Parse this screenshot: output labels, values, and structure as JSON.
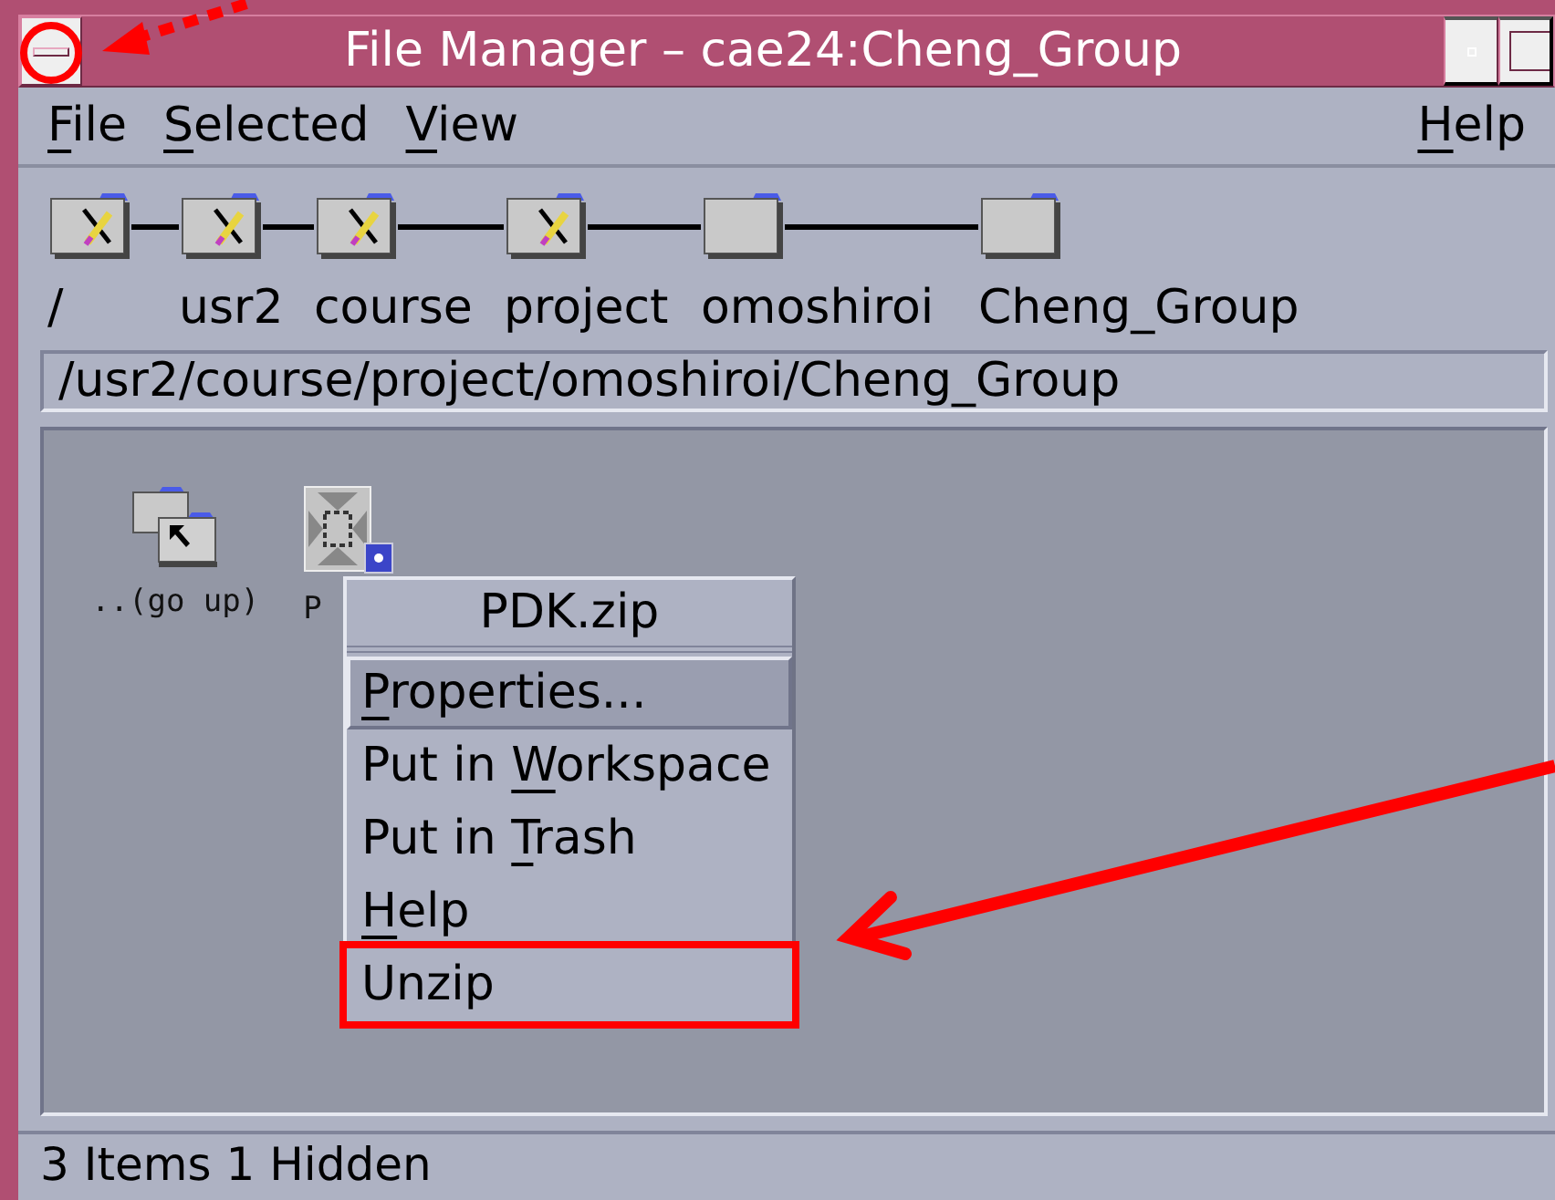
{
  "window": {
    "title": "File Manager – cae24:Cheng_Group"
  },
  "menu_bar": [
    {
      "label_parts": [
        {
          "text": "F",
          "underlined": true
        },
        {
          "text": "ile",
          "underlined": false
        }
      ]
    },
    {
      "label_parts": [
        {
          "text": "S",
          "underlined": true
        },
        {
          "text": "elected",
          "underlined": false
        }
      ]
    },
    {
      "label_parts": [
        {
          "text": "V",
          "underlined": true
        },
        {
          "text": "iew",
          "underlined": false
        }
      ]
    }
  ],
  "help_menu": {
    "label_parts": [
      {
        "text": "H",
        "underlined": true
      },
      {
        "text": "elp",
        "underlined": false
      }
    ]
  },
  "path_buttons": [
    {
      "label": "/",
      "writable": false
    },
    {
      "label": "usr2",
      "writable": false
    },
    {
      "label": "course",
      "writable": false
    },
    {
      "label": "project",
      "writable": false
    },
    {
      "label": "omoshiroi",
      "writable": true
    },
    {
      "label": "Cheng_Group",
      "writable": true
    }
  ],
  "path_field": {
    "value": "/usr2/course/project/omoshiroi/Cheng_Group"
  },
  "files": [
    {
      "label": "..(go up)",
      "kind": "parent"
    },
    {
      "label": "P",
      "kind": "archive"
    }
  ],
  "context_menu": {
    "title": "PDK.zip",
    "items": [
      {
        "label_parts": [
          {
            "text": "P",
            "underlined": true
          },
          {
            "text": "roperties...",
            "underlined": false
          }
        ],
        "selected": true,
        "annotated": false
      },
      {
        "label_parts": [
          {
            "text": "Put in ",
            "underlined": false
          },
          {
            "text": "W",
            "underlined": true
          },
          {
            "text": "orkspace",
            "underlined": false
          }
        ],
        "selected": false,
        "annotated": false
      },
      {
        "label_parts": [
          {
            "text": "Put in ",
            "underlined": false
          },
          {
            "text": "T",
            "underlined": true
          },
          {
            "text": "rash",
            "underlined": false
          }
        ],
        "selected": false,
        "annotated": false
      },
      {
        "label_parts": [
          {
            "text": "H",
            "underlined": true
          },
          {
            "text": "elp",
            "underlined": false
          }
        ],
        "selected": false,
        "annotated": false
      },
      {
        "label_parts": [
          {
            "text": "Unzip",
            "underlined": false
          }
        ],
        "selected": false,
        "annotated": true
      }
    ]
  },
  "status_bar": {
    "text": "3 Items 1 Hidden"
  }
}
